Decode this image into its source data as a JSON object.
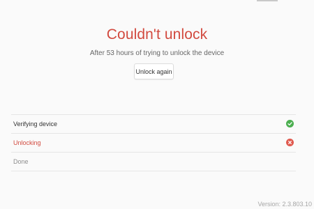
{
  "header": {
    "title": "Couldn't unlock",
    "subtitle": "After 53 hours of trying to unlock the device",
    "unlock_again_label": "Unlock again"
  },
  "steps": [
    {
      "label": "Verifying device",
      "status": "success",
      "icon": "check-circle-icon"
    },
    {
      "label": "Unlocking",
      "status": "error",
      "icon": "error-circle-icon"
    },
    {
      "label": "Done",
      "status": "pending",
      "icon": ""
    }
  ],
  "footer": {
    "version": "Version: 2.3.803.10"
  },
  "colors": {
    "error": "#d24a3f",
    "success": "#4caf50",
    "text": "#333333",
    "muted": "#8c8c8c",
    "background": "#fafafa"
  }
}
